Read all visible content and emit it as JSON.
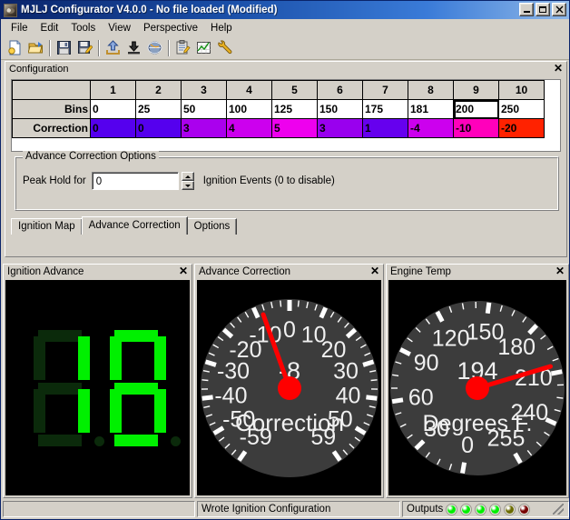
{
  "window": {
    "title": "MJLJ Configurator V4.0.0 - No file loaded (Modified)",
    "minimize_label": "_",
    "maximize_label": "□",
    "close_label": "✕"
  },
  "menubar": {
    "items": [
      {
        "label": "File"
      },
      {
        "label": "Edit"
      },
      {
        "label": "Tools"
      },
      {
        "label": "View"
      },
      {
        "label": "Perspective"
      },
      {
        "label": "Help"
      }
    ]
  },
  "toolbar": {
    "buttons": [
      {
        "icon": "new-file-icon"
      },
      {
        "icon": "open-folder-icon"
      },
      {
        "icon": "save-icon"
      },
      {
        "icon": "save-as-icon"
      },
      {
        "icon": "upload-icon"
      },
      {
        "icon": "download-icon"
      },
      {
        "icon": "globe-icon"
      },
      {
        "icon": "clipboard-icon"
      },
      {
        "icon": "chart-icon"
      },
      {
        "icon": "wrench-icon"
      }
    ]
  },
  "config_panel": {
    "title": "Configuration",
    "close_label": "✕",
    "table": {
      "corner_label": "",
      "column_headers": [
        "1",
        "2",
        "3",
        "4",
        "5",
        "6",
        "7",
        "8",
        "9",
        "10"
      ],
      "rows": [
        {
          "header": "Bins",
          "values": [
            "0",
            "25",
            "50",
            "100",
            "125",
            "150",
            "175",
            "181",
            "200",
            "250"
          ],
          "selected_index": 8
        },
        {
          "header": "Correction",
          "values": [
            "0",
            "0",
            "3",
            "4",
            "5",
            "3",
            "1",
            "-4",
            "-10",
            "-20"
          ],
          "colors": [
            "#5500ee",
            "#5500ee",
            "#aa00ee",
            "#cc00ee",
            "#ee00ee",
            "#9900ee",
            "#6600ee",
            "#cc00ee",
            "#ff00bb",
            "#ff2200"
          ]
        }
      ]
    },
    "options_group": {
      "title": "Advance Correction Options",
      "field_label": "Peak Hold for",
      "field_value": "0",
      "field_placeholder": "0",
      "hint": "Ignition Events (0 to disable)"
    },
    "tabs": [
      {
        "label": "Ignition Map",
        "active": false
      },
      {
        "label": "Advance Correction",
        "active": true
      },
      {
        "label": "Options",
        "active": false
      }
    ]
  },
  "gauges": [
    {
      "title": "Ignition Advance",
      "close_label": "✕",
      "type": "seven-segment",
      "value": "18",
      "on_color": "#00f000",
      "off_color": "#0b2a0b",
      "background": "#000000"
    },
    {
      "title": "Advance Correction",
      "close_label": "✕",
      "type": "dial",
      "value": "-8",
      "caption": "Correction",
      "min": -59,
      "max": 59,
      "ticks": [
        "-59",
        "-50",
        "-40",
        "-30",
        "-20",
        "-10",
        "0",
        "10",
        "20",
        "30",
        "40",
        "50",
        "59"
      ],
      "needle_color": "#ff0000",
      "face_color": "#3c3c3c"
    },
    {
      "title": "Engine Temp",
      "close_label": "✕",
      "type": "dial",
      "value": "194",
      "caption": "Degrees F.",
      "min": 0,
      "max": 255,
      "ticks": [
        "0",
        "30",
        "60",
        "90",
        "120",
        "150",
        "180",
        "210",
        "240",
        "255"
      ],
      "needle_color": "#ff0000",
      "face_color": "#3c3c3c"
    }
  ],
  "statusbar": {
    "pane1": "",
    "pane2": "Wrote Ignition Configuration",
    "outputs_label": "Outputs",
    "leds": [
      {
        "color": "#00ee00"
      },
      {
        "color": "#00ee00"
      },
      {
        "color": "#00ee00"
      },
      {
        "color": "#00ee00"
      },
      {
        "color": "#6b6b00"
      },
      {
        "color": "#770000"
      }
    ]
  }
}
